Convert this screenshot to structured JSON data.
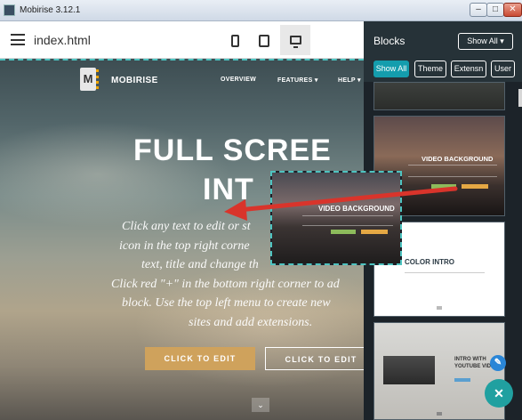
{
  "window": {
    "title": "Mobirise 3.12.1",
    "min": "–",
    "max": "□",
    "close": "✕"
  },
  "topbar": {
    "filename": "index.html"
  },
  "hero": {
    "brand": "MOBIRISE",
    "logo_letter": "M",
    "nav": [
      "OVERVIEW",
      "FEATURES ▾",
      "HELP ▾"
    ],
    "title_line1": "FULL SCREE",
    "title_line2": "INT",
    "text_lines": [
      "Click any text to edit or st",
      "icon in the top right corne",
      "text, title and change th",
      "Click red \"+\" in the bottom right corner to ad",
      "block. Use the top left menu to create new",
      "sites and add extensions."
    ],
    "primary_button": "CLICK TO EDIT",
    "secondary_button": "CLICK TO EDIT",
    "scroll_glyph": "⌄"
  },
  "dragged_block": {
    "title": "VIDEO BACKGROUND"
  },
  "panel": {
    "title": "Blocks",
    "dropdown": "Show All ▾",
    "filters": [
      "Show All",
      "Theme",
      "Extensn",
      "User"
    ],
    "thumbs": {
      "video_background": "VIDEO BACKGROUND",
      "color_intro": "COLOR INTRO",
      "intro_youtube": "INTRO WITH YOUTUBE VIDEO"
    }
  },
  "fabs": {
    "edit": "✎",
    "add": "✕"
  },
  "colors": {
    "accent": "#149dad",
    "panel_bg": "#263238",
    "cta": "#cfa25c",
    "arrow": "#d9342b",
    "dash": "#4ec3c0"
  }
}
